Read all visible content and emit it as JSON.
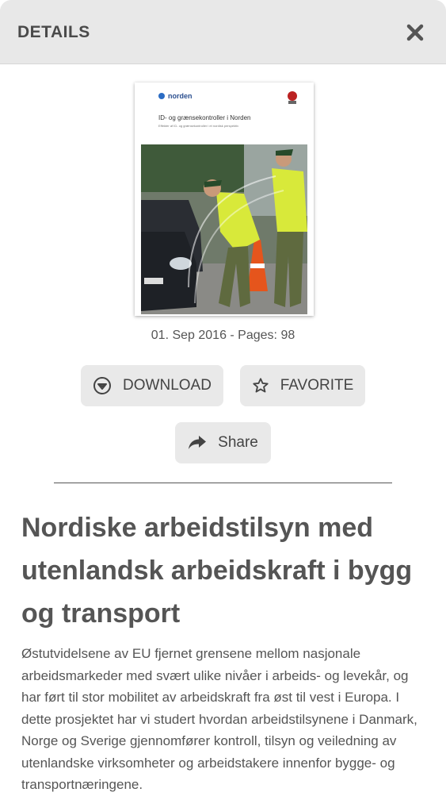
{
  "header": {
    "title": "DETAILS",
    "close_icon": "close-icon"
  },
  "cover": {
    "brand": "norden",
    "title": "ID- og grænsekontroller i Norden",
    "subtitle": "Effekter af ID- og grænsekontroller i et nordisk perspektiv"
  },
  "meta": {
    "text": "01. Sep 2016 - Pages: 98"
  },
  "actions": {
    "download_label": "DOWNLOAD",
    "download_icon": "download-icon",
    "favorite_label": "FAVORITE",
    "favorite_icon": "star-icon",
    "share_label": "Share",
    "share_icon": "share-icon"
  },
  "document": {
    "title": "Nordiske arbeidstilsyn med utenlandsk arbeidskraft i bygg og transport",
    "description": "Østutvidelsene av EU fjernet grensene mellom nasjonale arbeidsmarkeder med svært ulike nivåer i arbeids- og levekår, og har ført til stor mobilitet av arbeidskraft fra øst til vest i Europa. I dette prosjektet har vi studert hvordan arbeidstilsynene i Danmark, Norge og Sverige gjennomfører kontroll, tilsyn og veiledning av utenlandske virksomheter og arbeidstakere innenfor bygge- og transportnæringene."
  },
  "colors": {
    "header_bg": "#e8e8e8",
    "button_bg": "#e9e9e9",
    "text": "#555555"
  }
}
